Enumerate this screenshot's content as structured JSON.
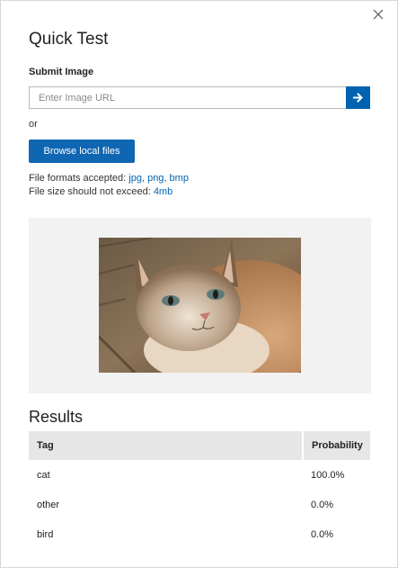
{
  "dialog": {
    "title": "Quick Test",
    "close_icon": "close-icon"
  },
  "submit": {
    "label": "Submit Image",
    "url_placeholder": "Enter Image URL",
    "url_value": "",
    "go_icon": "arrow-right-icon",
    "or_text": "or",
    "browse_label": "Browse local files",
    "formats_prefix": "File formats accepted: ",
    "formats_value": "jpg, png, bmp",
    "size_prefix": "File size should not exceed: ",
    "size_value": "4mb"
  },
  "colors": {
    "accent": "#0063b1",
    "panel_bg": "#f2f2f2",
    "header_bg": "#e6e6e6"
  },
  "results": {
    "title": "Results",
    "columns": [
      "Tag",
      "Probability"
    ],
    "rows": [
      {
        "tag": "cat",
        "probability": "100.0%"
      },
      {
        "tag": "other",
        "probability": "0.0%"
      },
      {
        "tag": "bird",
        "probability": "0.0%"
      }
    ]
  }
}
